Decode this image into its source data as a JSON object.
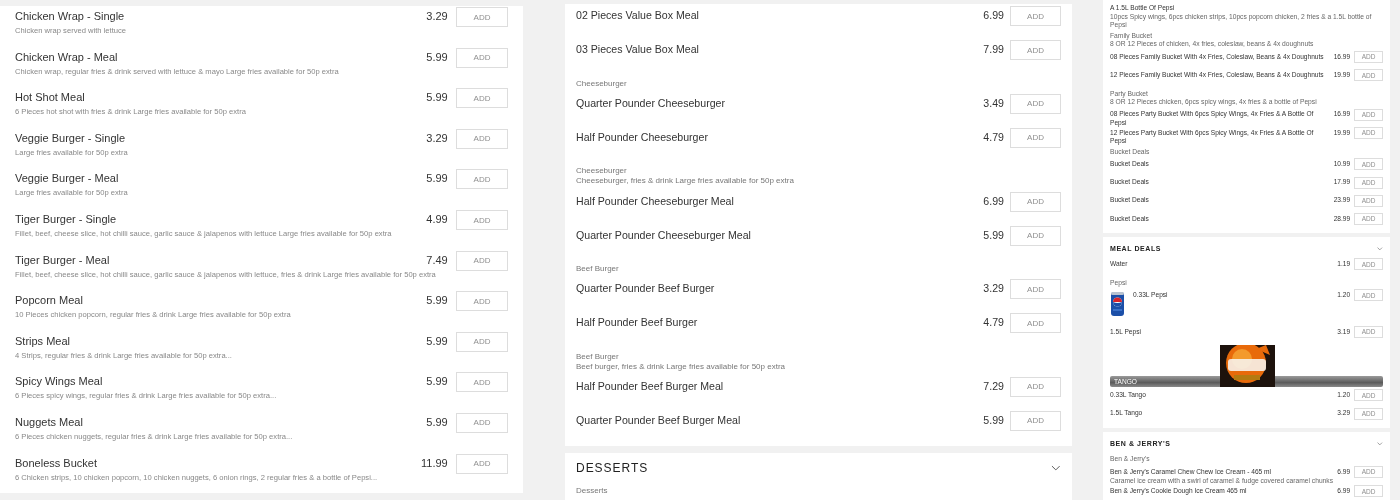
{
  "columns": [
    {
      "cards": [
        {
          "entries": [
            {
              "kind": "item",
              "name": "Chicken Wrap - Single",
              "description": "Chicken wrap served with lettuce",
              "price": "3.29",
              "button": "ADD"
            },
            {
              "kind": "item",
              "name": "Chicken Wrap - Meal",
              "description": "Chicken wrap, regular fries & drink served with lettuce & mayo Large fries available for 50p extra",
              "price": "5.99",
              "button": "ADD"
            },
            {
              "kind": "item",
              "name": "Hot Shot Meal",
              "description": "6 Pieces hot shot with fries & drink Large fries available for 50p extra",
              "price": "5.99",
              "button": "ADD"
            },
            {
              "kind": "item",
              "name": "Veggie Burger - Single",
              "description": "Large fries available for 50p extra",
              "price": "3.29",
              "button": "ADD"
            },
            {
              "kind": "item",
              "name": "Veggie Burger - Meal",
              "description": "Large fries available for 50p extra",
              "price": "5.99",
              "button": "ADD"
            },
            {
              "kind": "item",
              "name": "Tiger Burger - Single",
              "description": "Fillet, beef, cheese slice, hot chilli sauce, garlic sauce & jalapenos with lettuce Large fries available for 50p extra",
              "price": "4.99",
              "button": "ADD"
            },
            {
              "kind": "item",
              "name": "Tiger Burger - Meal",
              "description": "Fillet, beef, cheese slice, hot chilli sauce, garlic sauce & jalapenos with lettuce, fries & drink Large fries available for 50p extra",
              "price": "7.49",
              "button": "ADD"
            },
            {
              "kind": "item",
              "name": "Popcorn Meal",
              "description": "10 Pieces chicken popcorn, regular fries & drink Large fries available for 50p extra",
              "price": "5.99",
              "button": "ADD"
            },
            {
              "kind": "item",
              "name": "Strips Meal",
              "description": "4 Strips, regular fries & drink Large fries available for 50p extra...",
              "price": "5.99",
              "button": "ADD"
            },
            {
              "kind": "item",
              "name": "Spicy Wings Meal",
              "description": "6 Pieces spicy wings, regular fries & drink Large fries available for 50p extra...",
              "price": "5.99",
              "button": "ADD"
            },
            {
              "kind": "item",
              "name": "Nuggets Meal",
              "description": "6 Pieces chicken nuggets, regular fries & drink Large fries available for 50p extra...",
              "price": "5.99",
              "button": "ADD"
            },
            {
              "kind": "item",
              "name": "Boneless Bucket",
              "description": "6 Chicken strips, 10 chicken popcorn, 10 chicken nuggets, 6 onion rings, 2 regular fries & a bottle of Pepsi...",
              "price": "11.99",
              "button": "ADD"
            }
          ]
        }
      ]
    },
    {
      "cards": [
        {
          "entries": [
            {
              "kind": "item",
              "name": "02 Pieces Value Box Meal",
              "price": "6.99",
              "button": "ADD"
            },
            {
              "kind": "item",
              "name": "03 Pieces Value Box Meal",
              "price": "7.99",
              "button": "ADD"
            },
            {
              "kind": "group",
              "label": "Cheeseburger"
            },
            {
              "kind": "item",
              "name": "Quarter Pounder Cheeseburger",
              "price": "3.49",
              "button": "ADD"
            },
            {
              "kind": "item",
              "name": "Half Pounder Cheeseburger",
              "price": "4.79",
              "button": "ADD"
            },
            {
              "kind": "group",
              "label": "Cheeseburger",
              "description": "Cheeseburger, fries & drink Large fries available for 50p extra"
            },
            {
              "kind": "item",
              "name": "Half Pounder Cheeseburger Meal",
              "price": "6.99",
              "button": "ADD"
            },
            {
              "kind": "item",
              "name": "Quarter Pounder Cheeseburger Meal",
              "price": "5.99",
              "button": "ADD"
            },
            {
              "kind": "group",
              "label": "Beef Burger"
            },
            {
              "kind": "item",
              "name": "Quarter Pounder Beef Burger",
              "price": "3.29",
              "button": "ADD"
            },
            {
              "kind": "item",
              "name": "Half Pounder Beef Burger",
              "price": "4.79",
              "button": "ADD"
            },
            {
              "kind": "group",
              "label": "Beef Burger",
              "description": "Beef burger, fries & drink Large fries available for 50p extra"
            },
            {
              "kind": "item",
              "name": "Half Pounder Beef Burger Meal",
              "price": "7.29",
              "button": "ADD"
            },
            {
              "kind": "item",
              "name": "Quarter Pounder Beef Burger Meal",
              "price": "5.99",
              "button": "ADD"
            }
          ]
        },
        {
          "title": "DESSERTS",
          "entries": [
            {
              "kind": "group",
              "label": "Desserts"
            }
          ]
        }
      ]
    },
    {
      "cards": [
        {
          "entries": [
            {
              "kind": "item",
              "name": "A 1.5L Bottle Of Pepsi",
              "description": "10pcs Spicy wings, 6pcs chicken strips, 10pcs popcorn chicken, 2 fries & a 1.5L bottle of Pepsi"
            },
            {
              "kind": "group",
              "label": "Family Bucket",
              "description": "8 OR 12 Pieces of chicken, 4x fries, coleslaw, beans & 4x doughnuts"
            },
            {
              "kind": "item",
              "name": "08 Pieces Family Bucket With 4x Fries, Coleslaw, Beans & 4x Doughnuts",
              "price": "16.99",
              "button": "ADD"
            },
            {
              "kind": "item",
              "name": "12 Pieces Family Bucket With 4x Fries, Coleslaw, Beans & 4x Doughnuts",
              "price": "19.99",
              "button": "ADD"
            },
            {
              "kind": "group",
              "label": "Party Bucket",
              "description": "8 OR 12 Pieces chicken, 6pcs spicy wings, 4x fries & a bottle of Pepsi"
            },
            {
              "kind": "item",
              "name": "08 Pieces Party Bucket With 6pcs Spicy Wings, 4x Fries & A Bottle Of Pepsi",
              "price": "16.99",
              "button": "ADD"
            },
            {
              "kind": "item",
              "name": "12 Pieces Party Bucket With 6pcs Spicy Wings, 4x Fries & A Bottle Of Pepsi",
              "price": "19.99",
              "button": "ADD"
            },
            {
              "kind": "group",
              "label": "Bucket Deals"
            },
            {
              "kind": "item",
              "name": "Bucket Deals",
              "price": "10.99",
              "button": "ADD"
            },
            {
              "kind": "item",
              "name": "Bucket Deals",
              "price": "17.99",
              "button": "ADD"
            },
            {
              "kind": "item",
              "name": "Bucket Deals",
              "price": "23.99",
              "button": "ADD"
            },
            {
              "kind": "item",
              "name": "Bucket Deals",
              "price": "28.99",
              "button": "ADD"
            }
          ]
        },
        {
          "title": "MEAL DEALS",
          "entries": [
            {
              "kind": "item",
              "name": "Water",
              "price": "1.19",
              "button": "ADD"
            },
            {
              "kind": "group",
              "label": "Pepsi"
            },
            {
              "kind": "photo_item",
              "name": "0.33L Pepsi",
              "price": "1.20",
              "button": "ADD"
            },
            {
              "kind": "item",
              "name": "1.5L Pepsi",
              "price": "3.19",
              "button": "ADD"
            },
            {
              "kind": "banner",
              "title": "TANGO"
            },
            {
              "kind": "item",
              "name": "0.33L Tango",
              "price": "1.20",
              "button": "ADD"
            },
            {
              "kind": "item",
              "name": "1.5L Tango",
              "price": "3.29",
              "button": "ADD"
            }
          ]
        },
        {
          "title": "BEN & JERRY'S",
          "entries": [
            {
              "kind": "group",
              "label": "Ben & Jerry's"
            },
            {
              "kind": "item",
              "name": "Ben & Jerry's Caramel Chew Chew Ice Cream - 465 ml",
              "description": "Caramel ice cream with a swirl of caramel & fudge covered caramel chunks",
              "price": "6.99",
              "button": "ADD"
            },
            {
              "kind": "item",
              "name": "Ben & Jerry's Cookie Dough Ice Cream 465 ml",
              "price": "6.99",
              "button": "ADD"
            }
          ]
        }
      ]
    }
  ]
}
